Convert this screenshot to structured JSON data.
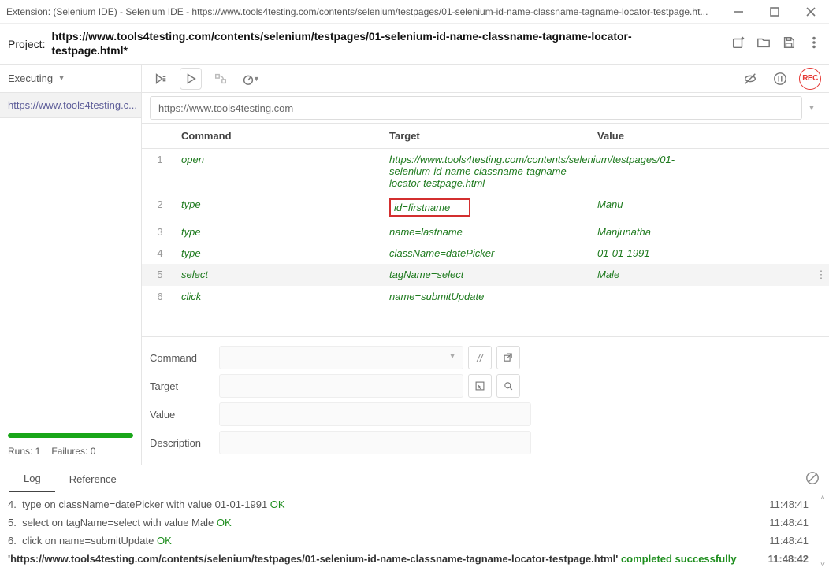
{
  "window": {
    "title": "Extension: (Selenium IDE) - Selenium IDE - https://www.tools4testing.com/contents/selenium/testpages/01-selenium-id-name-classname-tagname-locator-testpage.ht..."
  },
  "project": {
    "label": "Project:",
    "name": "https://www.tools4testing.com/contents/selenium/testpages/01-selenium-id-name-classname-tagname-locator-testpage.html*"
  },
  "sidebar": {
    "dropdown_label": "Executing",
    "test_item": "https://www.tools4testing.c...",
    "runs_label": "Runs: 1",
    "failures_label": "Failures: 0"
  },
  "url_bar": {
    "value": "https://www.tools4testing.com"
  },
  "headers": {
    "command": "Command",
    "target": "Target",
    "value": "Value"
  },
  "rows": [
    {
      "n": "1",
      "cmd": "open",
      "tgt": "https://www.tools4testing.com/contents/selenium/testpages/01-selenium-id-name-classname-tagname-locator-testpage.html",
      "val": ""
    },
    {
      "n": "2",
      "cmd": "type",
      "tgt": "id=firstname",
      "val": "Manu"
    },
    {
      "n": "3",
      "cmd": "type",
      "tgt": "name=lastname",
      "val": "Manjunatha"
    },
    {
      "n": "4",
      "cmd": "type",
      "tgt": "className=datePicker",
      "val": "01-01-1991"
    },
    {
      "n": "5",
      "cmd": "select",
      "tgt": "tagName=select",
      "val": "Male"
    },
    {
      "n": "6",
      "cmd": "click",
      "tgt": "name=submitUpdate",
      "val": ""
    }
  ],
  "editor": {
    "command_label": "Command",
    "target_label": "Target",
    "value_label": "Value",
    "description_label": "Description"
  },
  "bottom_tabs": {
    "log": "Log",
    "reference": "Reference"
  },
  "log": [
    {
      "n": "4.",
      "text": "type on className=datePicker with value 01-01-1991",
      "status": "OK",
      "time": "11:48:41"
    },
    {
      "n": "5.",
      "text": "select on tagName=select with value Male",
      "status": "OK",
      "time": "11:48:41"
    },
    {
      "n": "6.",
      "text": "click on name=submitUpdate",
      "status": "OK",
      "time": "11:48:41"
    }
  ],
  "final_log": {
    "prefix": "'https://www.tools4testing.com/contents/selenium/testpages/01-selenium-id-name-classname-tagname-locator-testpage.html'",
    "status": "completed successfully",
    "time": "11:48:42"
  }
}
